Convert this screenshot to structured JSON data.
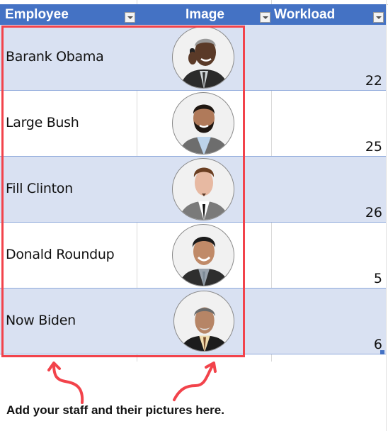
{
  "table": {
    "columns": [
      {
        "label": "Employee",
        "filter_icon": "filter-dropdown-icon"
      },
      {
        "label": "Image",
        "filter_icon": "filter-dropdown-icon"
      },
      {
        "label": "Workload",
        "filter_icon": "filter-dropdown-icon"
      }
    ],
    "rows": [
      {
        "employee": "Barank Obama",
        "image": "employee-photo",
        "workload": "22"
      },
      {
        "employee": "Large Bush",
        "image": "employee-photo",
        "workload": "25"
      },
      {
        "employee": "Fill Clinton",
        "image": "employee-photo",
        "workload": "26"
      },
      {
        "employee": "Donald Roundup",
        "image": "employee-photo",
        "workload": "5"
      },
      {
        "employee": "Now Biden",
        "image": "employee-photo",
        "workload": "6"
      }
    ]
  },
  "annotation": {
    "caption": "Add your staff and their pictures here.",
    "highlight_color": "#F2434B"
  },
  "colors": {
    "header_bg": "#4472C4",
    "band_bg": "#D9E1F2",
    "row_border": "#8EA9DB"
  }
}
